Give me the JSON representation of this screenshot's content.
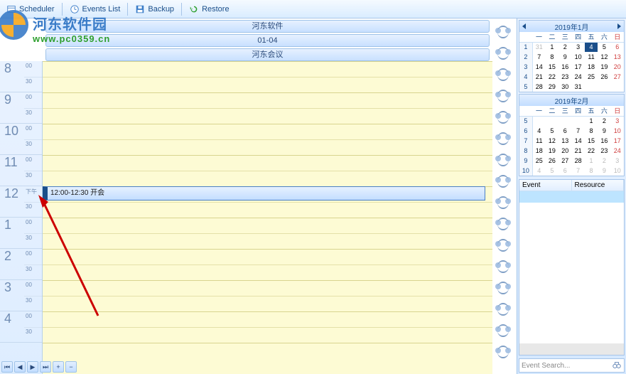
{
  "toolbar": {
    "scheduler": "Scheduler",
    "events_list": "Events List",
    "backup": "Backup",
    "restore": "Restore"
  },
  "headers": {
    "title": "河东软件",
    "date": "01-04",
    "resource": "河东会议"
  },
  "hours": [
    8,
    9,
    10,
    11,
    12,
    1,
    2,
    3,
    4
  ],
  "minute_labels": [
    "00",
    "30"
  ],
  "event": {
    "start": "12:00",
    "end": "12:30",
    "title": "开会"
  },
  "cal1": {
    "title": "2019年1月",
    "dow": [
      "一",
      "二",
      "三",
      "四",
      "五",
      "六",
      "日"
    ],
    "weeks": [
      {
        "wk": 1,
        "d": [
          "31",
          "1",
          "2",
          "3",
          "4",
          "5",
          "6"
        ],
        "dim": [
          0
        ]
      },
      {
        "wk": 2,
        "d": [
          "7",
          "8",
          "9",
          "10",
          "11",
          "12",
          "13"
        ]
      },
      {
        "wk": 3,
        "d": [
          "14",
          "15",
          "16",
          "17",
          "18",
          "19",
          "20"
        ]
      },
      {
        "wk": 4,
        "d": [
          "21",
          "22",
          "23",
          "24",
          "25",
          "26",
          "27"
        ]
      },
      {
        "wk": 5,
        "d": [
          "28",
          "29",
          "30",
          "31",
          "",
          "",
          ""
        ]
      }
    ],
    "selected": "4"
  },
  "cal2": {
    "title": "2019年2月",
    "dow": [
      "一",
      "二",
      "三",
      "四",
      "五",
      "六",
      "日"
    ],
    "weeks": [
      {
        "wk": 5,
        "d": [
          "",
          "",
          "",
          "",
          "1",
          "2",
          "3"
        ]
      },
      {
        "wk": 6,
        "d": [
          "4",
          "5",
          "6",
          "7",
          "8",
          "9",
          "10"
        ]
      },
      {
        "wk": 7,
        "d": [
          "11",
          "12",
          "13",
          "14",
          "15",
          "16",
          "17"
        ]
      },
      {
        "wk": 8,
        "d": [
          "18",
          "19",
          "20",
          "21",
          "22",
          "23",
          "24"
        ]
      },
      {
        "wk": 9,
        "d": [
          "25",
          "26",
          "27",
          "28",
          "1",
          "2",
          "3"
        ],
        "dim": [
          4,
          5,
          6
        ]
      },
      {
        "wk": 10,
        "d": [
          "4",
          "5",
          "6",
          "7",
          "8",
          "9",
          "10"
        ],
        "dim": [
          0,
          1,
          2,
          3,
          4,
          5,
          6
        ]
      }
    ]
  },
  "eventlist": {
    "col1": "Event",
    "col2": "Resource"
  },
  "search": {
    "placeholder": "Event Search..."
  },
  "watermark": {
    "line1": "河东软件园",
    "line2": "www.pc0359.cn"
  }
}
